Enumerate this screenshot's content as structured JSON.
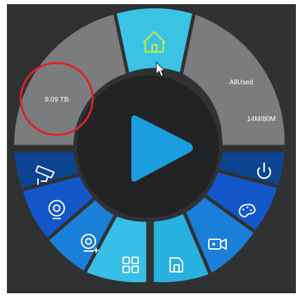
{
  "disk": {
    "capacity_text": "9.09 TB"
  },
  "storage": {
    "label": "AllUsed",
    "value": "14M/80M"
  },
  "colors": {
    "background": "#303133",
    "gray_segment": "#7b7c7e",
    "home_segment": "#3bc3e5",
    "dark_blue": "#0c4492",
    "mid_blue": "#1356c9",
    "blue": "#1a7fd8",
    "light_blue": "#27b1e0",
    "cyan": "#36bfe8",
    "center_disc": "#222324",
    "play_button": "#1a9ee0",
    "highlight_circle": "#dd2222",
    "home_icon": "#c9e649"
  },
  "icons": {
    "home": "home-icon",
    "play": "play-icon",
    "cctv": "cctv-camera-icon",
    "webcam": "webcam-icon",
    "webcam_add": "webcam-add-icon",
    "grid": "grid-icon",
    "folder": "file-icon",
    "video": "video-camera-icon",
    "palette": "palette-icon",
    "power": "power-icon"
  }
}
